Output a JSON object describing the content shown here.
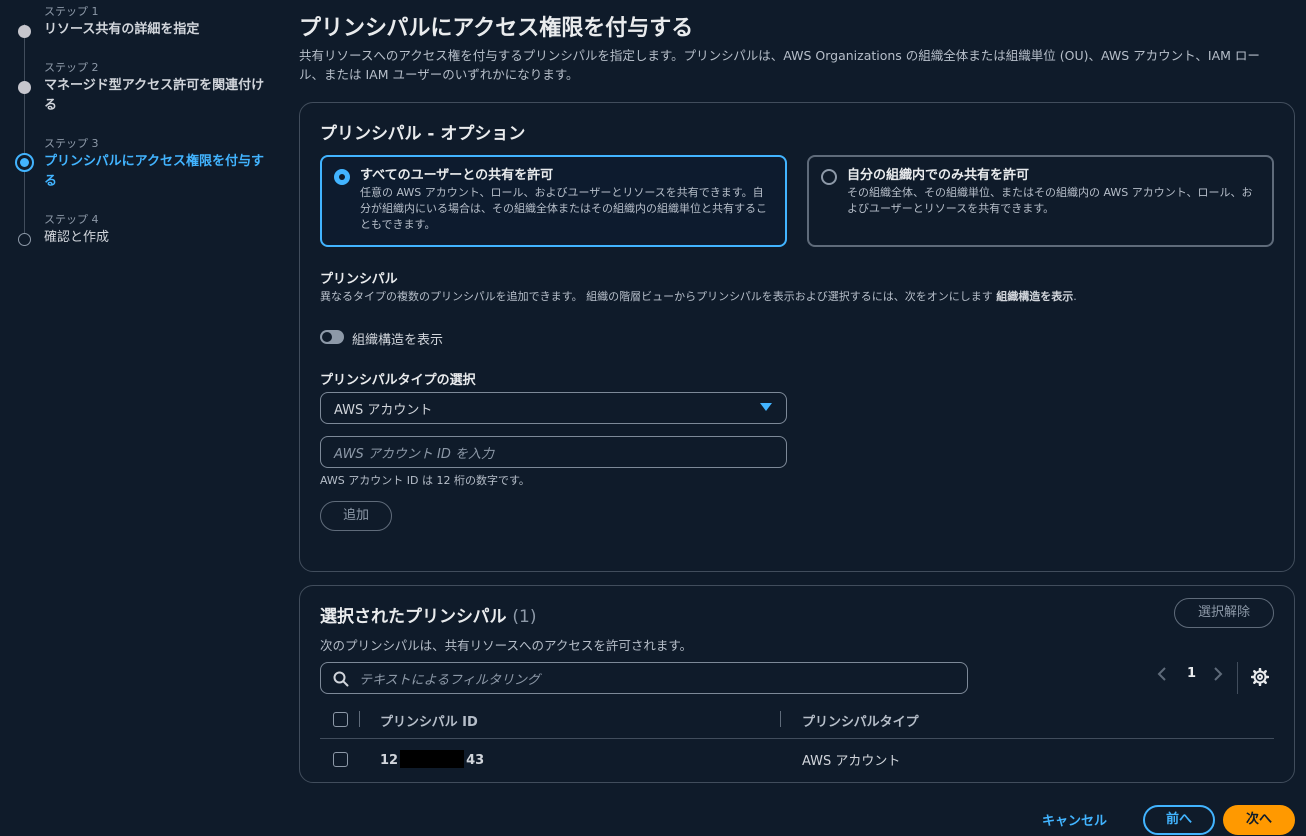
{
  "steps": [
    {
      "num": "ステップ 1",
      "title": "リソース共有の詳細を指定"
    },
    {
      "num": "ステップ 2",
      "title": "マネージド型アクセス許可を関連付ける"
    },
    {
      "num": "ステップ 3",
      "title": "プリンシパルにアクセス権限を付与する"
    },
    {
      "num": "ステップ 4",
      "title": "確認と作成"
    }
  ],
  "page": {
    "title": "プリンシパルにアクセス権限を付与する",
    "description": "共有リソースへのアクセス権を付与するプリンシパルを指定します。プリンシパルは、AWS Organizations の組織全体または組織単位 (OU)、AWS アカウント、IAM ロール、または IAM ユーザーのいずれかになります。"
  },
  "options_panel": {
    "heading": "プリンシパル - オプション",
    "tiles": [
      {
        "title": "すべてのユーザーとの共有を許可",
        "desc": "任意の AWS アカウント、ロール、およびユーザーとリソースを共有できます。自分が組織内にいる場合は、その組織全体またはその組織内の組織単位と共有することもできます。",
        "selected": true
      },
      {
        "title": "自分の組織内でのみ共有を許可",
        "desc": "その組織全体、その組織単位、またはその組織内の AWS アカウント、ロール、およびユーザーとリソースを共有できます。",
        "selected": false
      }
    ],
    "principal_label": "プリンシパル",
    "principal_hint": "異なるタイプの複数のプリンシパルを追加できます。 組織の階層ビューからプリンシパルを表示および選択するには、次をオンにします",
    "principal_hint_bold": "組織構造を表示",
    "principal_hint_end": ".",
    "toggle_label": "組織構造を表示",
    "type_label": "プリンシパルタイプの選択",
    "type_value": "AWS アカウント",
    "account_placeholder": "AWS アカウント ID を入力",
    "account_hint": "AWS アカウント ID は 12 桁の数字です。",
    "add_button": "追加"
  },
  "selected_panel": {
    "heading": "選択されたプリンシパル",
    "count": "(1)",
    "clear_button": "選択解除",
    "description": "次のプリンシパルは、共有リソースへのアクセスを許可されます。",
    "filter_placeholder": "テキストによるフィルタリング",
    "page_number": "1",
    "columns": [
      "プリンシパル ID",
      "プリンシパルタイプ"
    ],
    "rows": [
      {
        "id_prefix": "12",
        "id_suffix": "43",
        "type": "AWS アカウント"
      }
    ]
  },
  "footer": {
    "cancel": "キャンセル",
    "previous": "前へ",
    "next": "次へ"
  }
}
